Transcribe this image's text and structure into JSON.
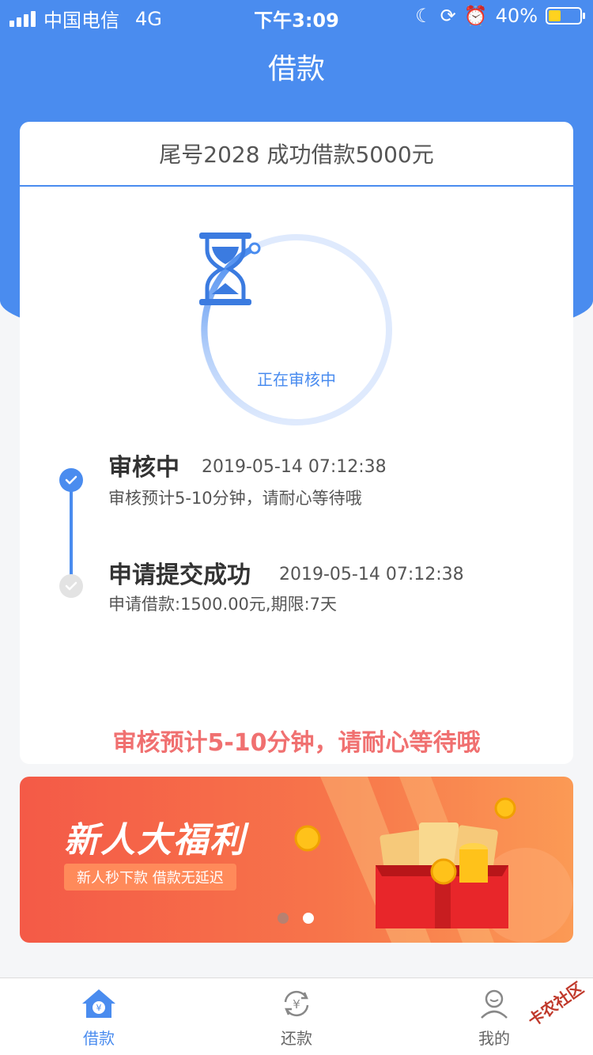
{
  "status_bar": {
    "carrier": "中国电信",
    "network": "4G",
    "time": "下午3:09",
    "battery": "40%",
    "battery_level": 0.4
  },
  "header": {
    "title": "借款"
  },
  "card": {
    "notice": "尾号2028 成功借款5000元",
    "status_label": "正在审核中",
    "progress": 0.03,
    "timeline": [
      {
        "title": "审核中",
        "time": "2019-05-14 07:12:38",
        "desc": "审核预计5-10分钟，请耐心等待哦"
      },
      {
        "title": "申请提交成功",
        "time": "2019-05-14 07:12:38",
        "desc": "申请借款:1500.00元,期限:7天"
      }
    ],
    "bottom_note": "审核预计5-10分钟，请耐心等待哦"
  },
  "banner": {
    "title": "新人大福利",
    "subtitle": "新人秒下款  借款无延迟",
    "page_count": 2,
    "active_page": 1
  },
  "tabbar": {
    "items": [
      {
        "label": "借款",
        "icon": "home-yen-icon",
        "active": true
      },
      {
        "label": "还款",
        "icon": "repay-cycle-icon",
        "active": false
      },
      {
        "label": "我的",
        "icon": "user-icon",
        "active": false
      }
    ]
  },
  "watermark": "卡农社区",
  "colors": {
    "primary": "#4a8cef",
    "warning_text": "#f07070",
    "tab_inactive": "#666666"
  }
}
